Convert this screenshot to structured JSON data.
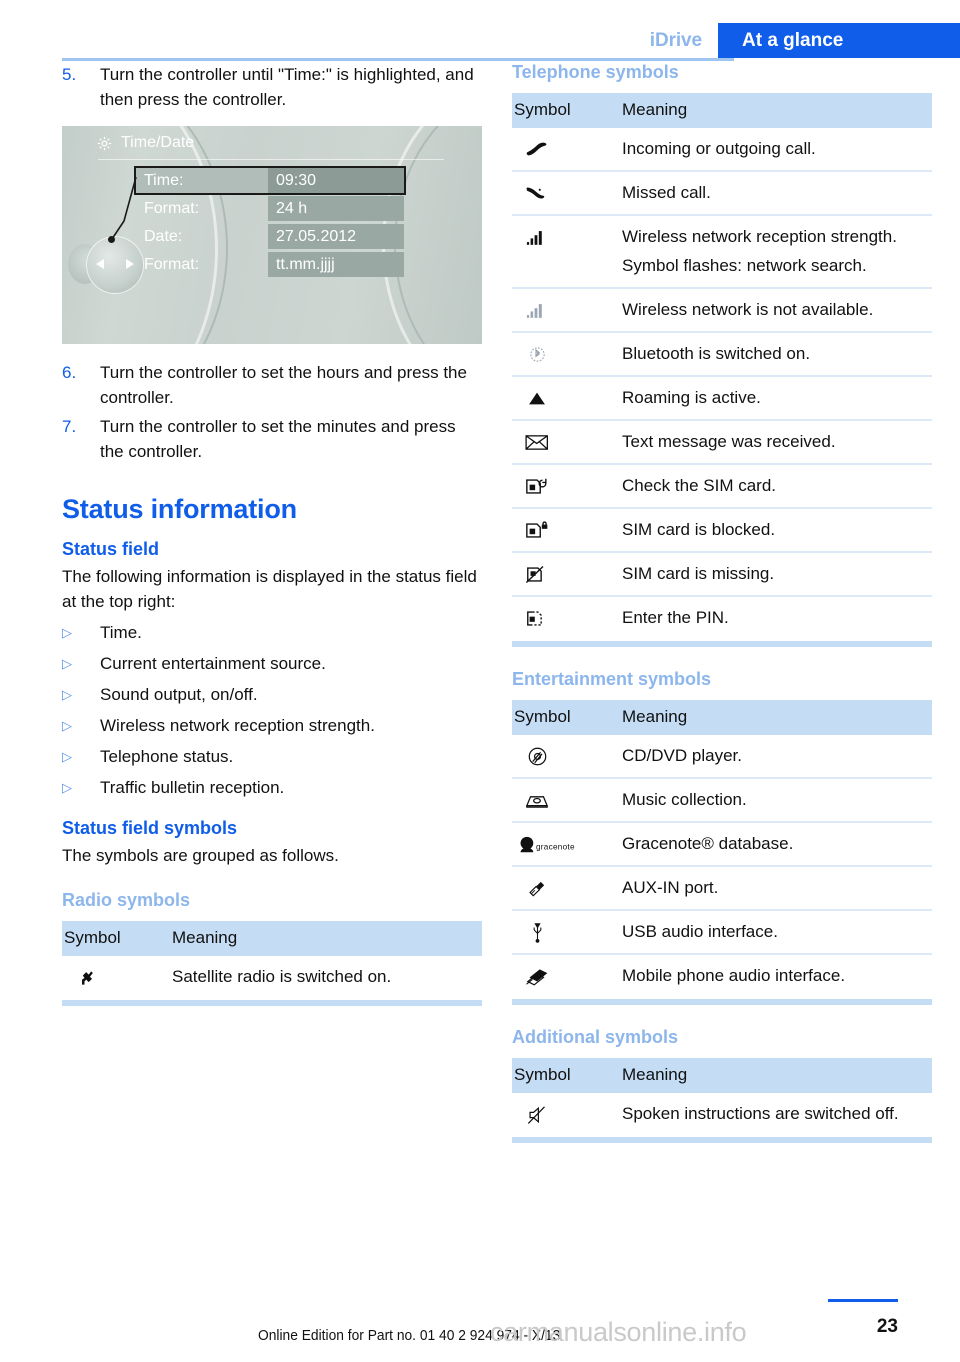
{
  "header": {
    "chapter": "iDrive",
    "section": "At a glance"
  },
  "left_column": {
    "steps": [
      {
        "num": "5.",
        "text": "Turn the controller until \"Time:\" is highlighted, and then press the controller."
      },
      {
        "num": "6.",
        "text": "Turn the controller to set the hours and press the controller."
      },
      {
        "num": "7.",
        "text": "Turn the controller to set the minutes and press the controller."
      }
    ],
    "figure": {
      "title": "Time/Date",
      "gear_icon": "gear-icon",
      "rows": [
        {
          "label": "Time:",
          "value": "09:30",
          "selected": true
        },
        {
          "label": "Format:",
          "value": "24 h",
          "selected": false
        },
        {
          "label": "Date:",
          "value": "27.05.2012",
          "selected": false
        },
        {
          "label": "Format:",
          "value": "tt.mm.jjjj",
          "selected": false
        }
      ]
    },
    "status_information_heading": "Status information",
    "status_field_heading": "Status field",
    "status_field_intro": "The following information is displayed in the status field at the top right:",
    "status_field_items": [
      "Time.",
      "Current entertainment source.",
      "Sound output, on/off.",
      "Wireless network reception strength.",
      "Telephone status.",
      "Traffic bulletin reception."
    ],
    "status_field_symbols_heading": "Status field symbols",
    "status_field_symbols_intro": "The symbols are grouped as follows.",
    "radio_symbols": {
      "heading": "Radio symbols",
      "columns": [
        "Symbol",
        "Meaning"
      ],
      "rows": [
        {
          "icon": "satellite-radio-icon",
          "meaning": "Satellite radio is switched on."
        }
      ]
    }
  },
  "right_column": {
    "telephone_symbols": {
      "heading": "Telephone symbols",
      "columns": [
        "Symbol",
        "Meaning"
      ],
      "rows": [
        {
          "icon": "phone-handset-icon",
          "meaning": "Incoming or outgoing call."
        },
        {
          "icon": "missed-call-icon",
          "meaning": "Missed call."
        },
        {
          "icon": "signal-bars-full-icon",
          "meaning": "Wireless network reception strength.",
          "note": "Symbol flashes: network search."
        },
        {
          "icon": "signal-bars-empty-icon",
          "meaning": "Wireless network is not available."
        },
        {
          "icon": "bluetooth-icon",
          "meaning": "Bluetooth is switched on."
        },
        {
          "icon": "roaming-triangle-icon",
          "meaning": "Roaming is active."
        },
        {
          "icon": "envelope-icon",
          "meaning": "Text message was received."
        },
        {
          "icon": "sim-check-icon",
          "meaning": "Check the SIM card."
        },
        {
          "icon": "sim-locked-icon",
          "meaning": "SIM card is blocked."
        },
        {
          "icon": "sim-missing-icon",
          "meaning": "SIM card is missing."
        },
        {
          "icon": "sim-pin-icon",
          "meaning": "Enter the PIN."
        }
      ]
    },
    "entertainment_symbols": {
      "heading": "Entertainment symbols",
      "columns": [
        "Symbol",
        "Meaning"
      ],
      "rows": [
        {
          "icon": "cd-dvd-icon",
          "meaning": "CD/DVD player."
        },
        {
          "icon": "music-collection-icon",
          "meaning": "Music collection."
        },
        {
          "icon": "gracenote-icon",
          "meaning": "Gracenote® database."
        },
        {
          "icon": "aux-in-plug-icon",
          "meaning": "AUX-IN port."
        },
        {
          "icon": "usb-icon",
          "meaning": "USB audio interface."
        },
        {
          "icon": "mobile-audio-icon",
          "meaning": "Mobile phone audio interface."
        }
      ]
    },
    "additional_symbols": {
      "heading": "Additional symbols",
      "columns": [
        "Symbol",
        "Meaning"
      ],
      "rows": [
        {
          "icon": "speaker-muted-icon",
          "meaning": "Spoken instructions are switched off."
        }
      ]
    }
  },
  "footer": {
    "edition_note": "Online Edition for Part no. 01 40 2 924 974 - X/13",
    "page_number": "23",
    "watermark": "carmanualsonline.info"
  },
  "colors": {
    "accent_blue": "#0f5de8",
    "light_blue_heading": "#8cb6ec",
    "table_header_bg": "#c4dcf4",
    "table_rule": "#dceaf8"
  }
}
